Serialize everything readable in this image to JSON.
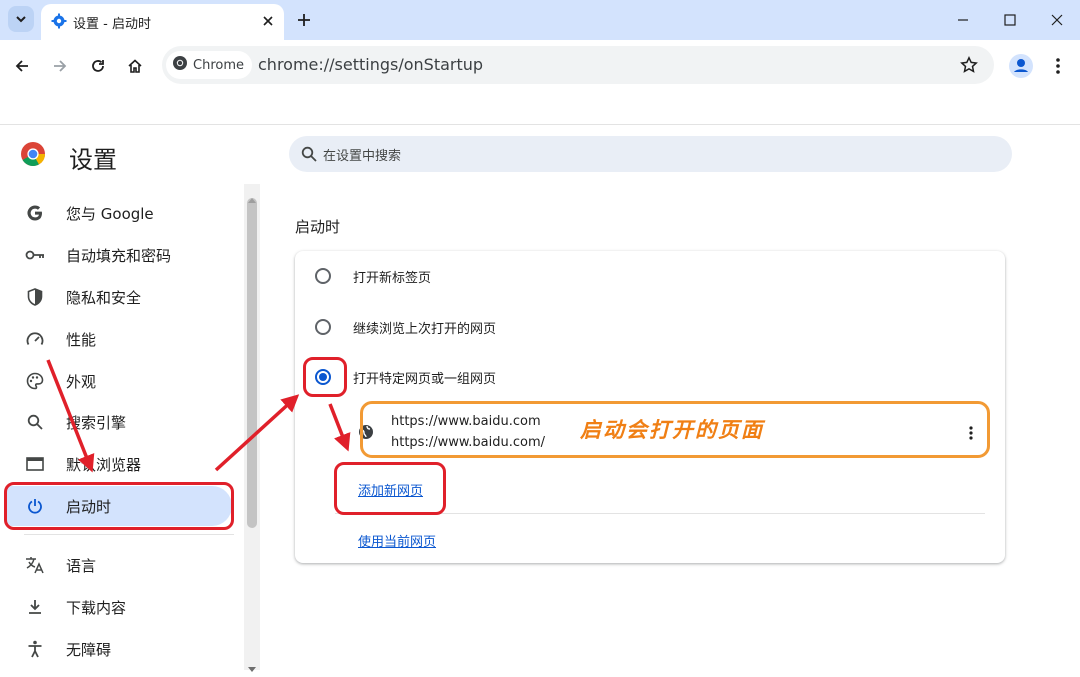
{
  "browser": {
    "tab_title": "设置 - 启动时",
    "omnibox_chip": "Chrome",
    "url": "chrome://settings/onStartup"
  },
  "sidebar": {
    "title": "设置",
    "items": [
      {
        "label": "您与 Google",
        "icon": "google-g-icon"
      },
      {
        "label": "自动填充和密码",
        "icon": "key-icon"
      },
      {
        "label": "隐私和安全",
        "icon": "shield-icon"
      },
      {
        "label": "性能",
        "icon": "speedometer-icon"
      },
      {
        "label": "外观",
        "icon": "palette-icon"
      },
      {
        "label": "搜索引擎",
        "icon": "search-icon"
      },
      {
        "label": "默认浏览器",
        "icon": "browser-window-icon"
      },
      {
        "label": "启动时",
        "icon": "power-icon",
        "active": true
      },
      {
        "label": "语言",
        "icon": "translate-icon"
      },
      {
        "label": "下载内容",
        "icon": "download-icon"
      },
      {
        "label": "无障碍",
        "icon": "accessibility-icon"
      }
    ]
  },
  "search": {
    "placeholder": "在设置中搜索"
  },
  "main": {
    "section_title": "启动时",
    "options": [
      {
        "label": "打开新标签页",
        "selected": false
      },
      {
        "label": "继续浏览上次打开的网页",
        "selected": false
      },
      {
        "label": "打开特定网页或一组网页",
        "selected": true
      }
    ],
    "startup_page": {
      "title": "https://www.baidu.com",
      "url": "https://www.baidu.com/"
    },
    "add_page_link": "添加新网页",
    "use_current_link": "使用当前网页"
  },
  "annotation": {
    "callout_text": "启动会打开的页面",
    "colors": {
      "red": "#e0202a",
      "orange": "#f29a34"
    }
  },
  "colors": {
    "accent": "#0b57d0",
    "titlebar": "#d3e3fd",
    "active_nav": "#d3e3fd"
  }
}
